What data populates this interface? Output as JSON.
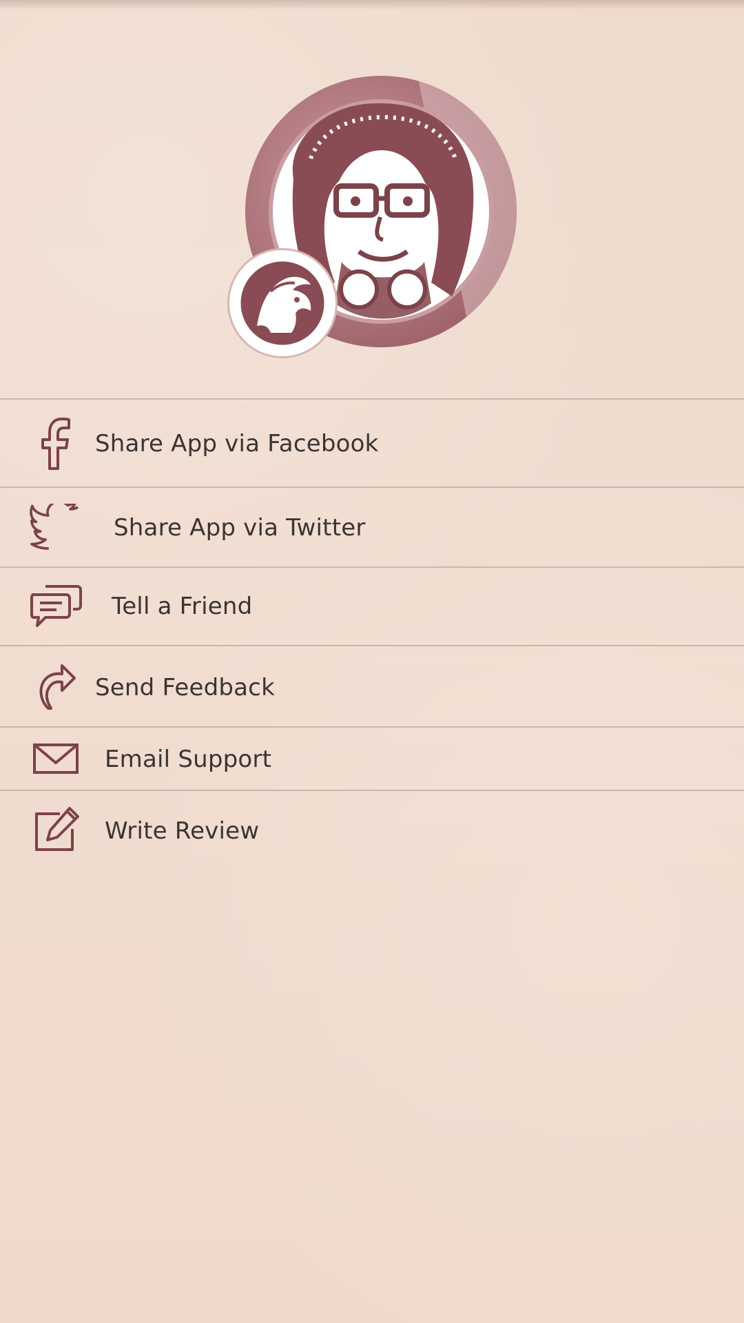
{
  "colors": {
    "background": "#f0dccf",
    "accent": "#7c4249",
    "divider": "#cbb4ad",
    "text": "#3a3434"
  },
  "menu": {
    "items": [
      {
        "label": "Share App via Facebook",
        "icon": "facebook-icon"
      },
      {
        "label": "Share App via Twitter",
        "icon": "twitter-icon"
      },
      {
        "label": "Tell a Friend",
        "icon": "chat-bubbles-icon"
      },
      {
        "label": "Send Feedback",
        "icon": "curved-arrow-icon"
      },
      {
        "label": "Email Support",
        "icon": "envelope-icon"
      },
      {
        "label": "Write Review",
        "icon": "edit-icon"
      }
    ]
  }
}
